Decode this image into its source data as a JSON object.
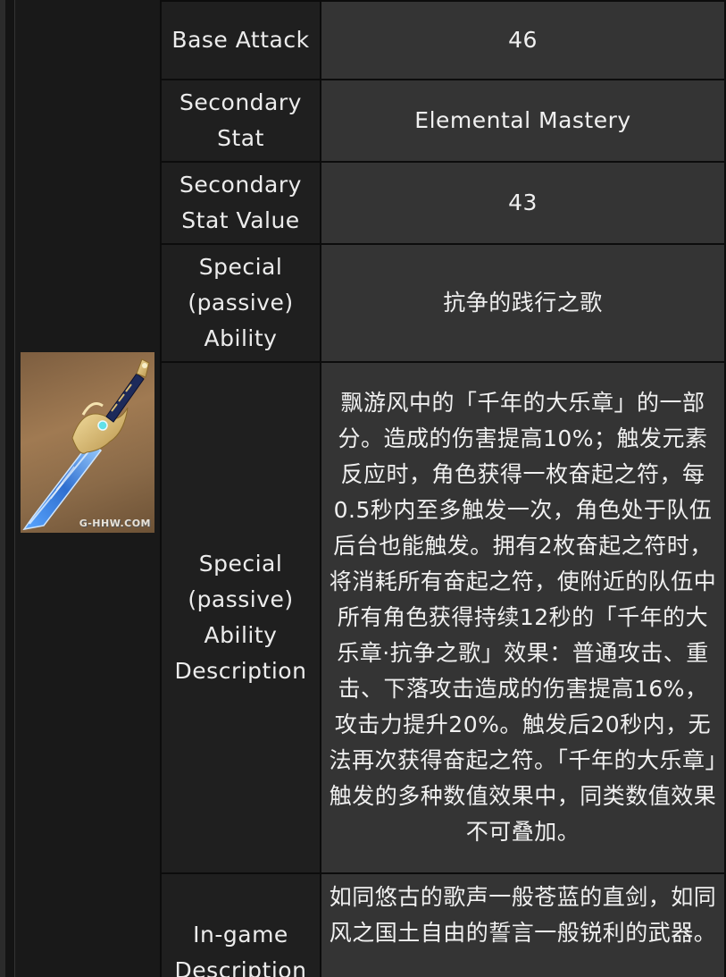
{
  "image": {
    "alt_icon": "sword-icon",
    "watermark": "G-HHW.COM",
    "colors": {
      "background": "#8a6a48",
      "blade": "#3a7fd6",
      "hilt": "#d8bb72"
    }
  },
  "rows": [
    {
      "label": "Base Attack",
      "value": "46"
    },
    {
      "label": "Secondary Stat",
      "value": "Elemental Mastery"
    },
    {
      "label": "Secondary Stat Value",
      "value": "43"
    },
    {
      "label": "Special (passive) Ability",
      "value": "抗争的践行之歌"
    },
    {
      "label": "Special (passive) Ability Description",
      "value": "飘游风中的「千年的大乐章」的一部分。造成的伤害提高10%；触发元素反应时，角色获得一枚奋起之符，每0.5秒内至多触发一次，角色处于队伍后台也能触发。拥有2枚奋起之符时，将消耗所有奋起之符，使附近的队伍中所有角色获得持续12秒的「千年的大乐章·抗争之歌」效果：普通攻击、重击、下落攻击造成的伤害提高16%，攻击力提升20%。触发后20秒内，无法再次获得奋起之符。「千年的大乐章」触发的多种数值效果中，同类数值效果不可叠加。"
    },
    {
      "label": "In-game Description",
      "value": "如同悠古的歌声一般苍蓝的直剑，如同风之国土自由的誓言一般锐利的武器。"
    }
  ]
}
